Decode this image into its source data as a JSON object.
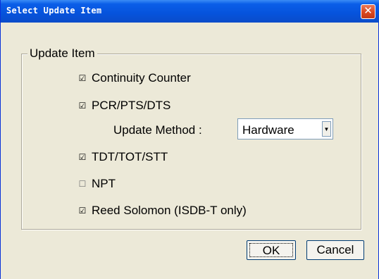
{
  "window": {
    "title": "Select Update Item"
  },
  "group": {
    "label": "Update Item"
  },
  "options": {
    "continuity_counter": {
      "label": "Continuity Counter",
      "checked": true
    },
    "pcr_pts_dts": {
      "label": "PCR/PTS/DTS",
      "checked": true
    },
    "tdt_tot_stt": {
      "label": "TDT/TOT/STT",
      "checked": true
    },
    "npt": {
      "label": "NPT",
      "checked": false
    },
    "reed_solomon": {
      "label": "Reed Solomon (ISDB-T only)",
      "checked": true
    }
  },
  "update_method": {
    "label": "Update Method :",
    "value": "Hardware"
  },
  "buttons": {
    "ok": "OK",
    "cancel": "Cancel"
  },
  "icons": {
    "checked": "☑",
    "unchecked": "☐",
    "close": "✕",
    "dropdown": "▾"
  }
}
